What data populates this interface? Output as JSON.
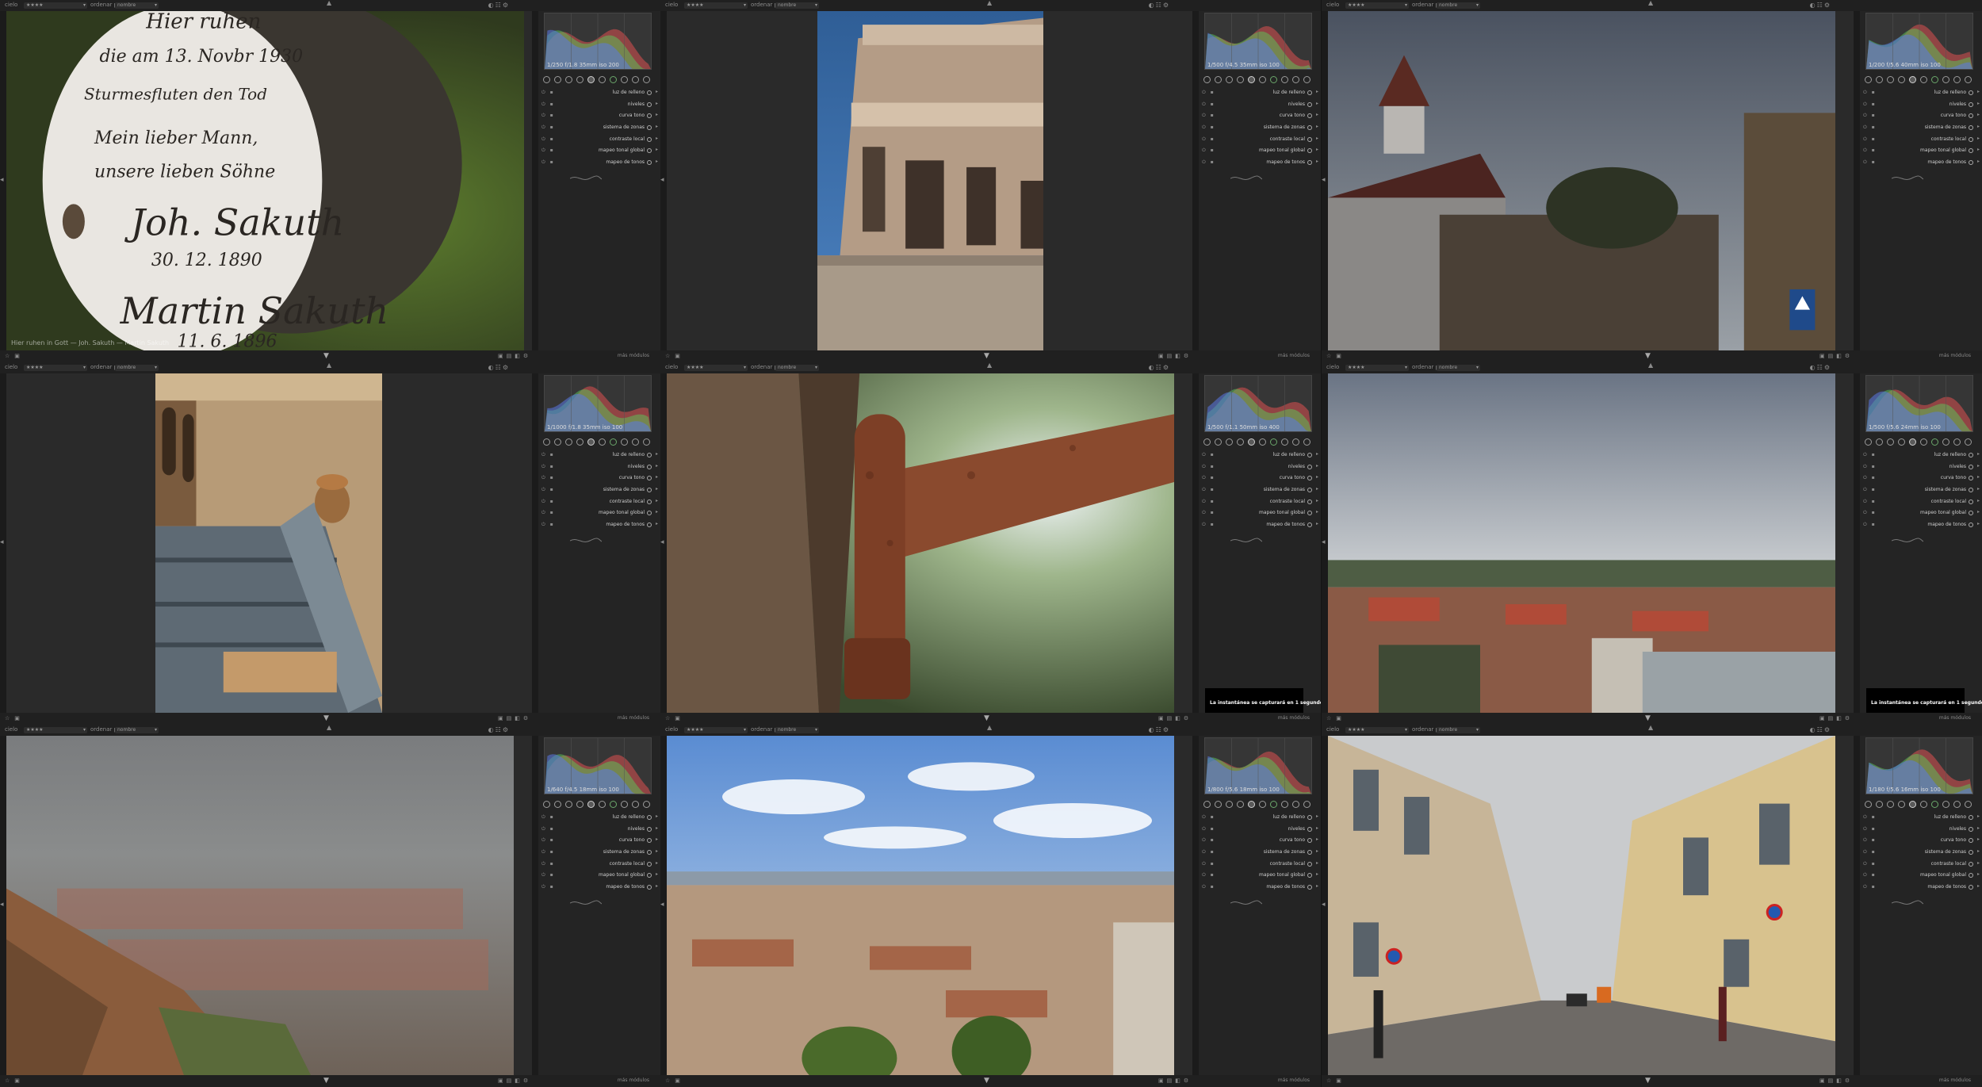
{
  "app": {
    "top_label": "cielo",
    "bottom_more_label": "más módulos",
    "sort_label": "ordenar por",
    "sort_value": "nombre",
    "rating_value": "★★★★"
  },
  "modules": [
    {
      "name": "luz de relleno",
      "icon": "circle-half-icon"
    },
    {
      "name": "niveles",
      "icon": "circle-icon"
    },
    {
      "name": "curva tono",
      "icon": "circle-icon"
    },
    {
      "name": "sistema de zonas",
      "icon": "zones-icon"
    },
    {
      "name": "contraste local",
      "icon": "circle-icon"
    },
    {
      "name": "mapeo tonal global",
      "icon": "circle-icon"
    },
    {
      "name": "mapeo de tonos",
      "icon": "tone-icon"
    }
  ],
  "cells": [
    {
      "exif": "1/250 f/1.8 35mm iso 200",
      "photo": {
        "name": "cemetery-plaque",
        "caption": "Hier ruhen in Gott — Joh. Sakuth — Martin Sakuth"
      },
      "toast": ""
    },
    {
      "exif": "1/500 f/4.5 35mm iso 100",
      "photo": {
        "name": "ruined-tower",
        "caption": ""
      },
      "toast": ""
    },
    {
      "exif": "1/200 f/5.6 40mm iso 100",
      "photo": {
        "name": "orthodox-church",
        "caption": ""
      },
      "toast": ""
    },
    {
      "exif": "1/1000 f/1.8 35mm iso 100",
      "photo": {
        "name": "weathered-boat",
        "caption": ""
      },
      "toast": ""
    },
    {
      "exif": "1/500 f/1.1 50mm iso 400",
      "photo": {
        "name": "rusty-hinge",
        "caption": ""
      },
      "toast": "La instantánea se capturará en 1 segundo"
    },
    {
      "exif": "1/500 f/5.6 24mm iso 100",
      "photo": {
        "name": "city-panorama",
        "caption": ""
      },
      "toast": "La instantánea se capturará en 1 segundo"
    },
    {
      "exif": "1/640 f/4.5 18mm iso 100",
      "photo": {
        "name": "foggy-city",
        "caption": ""
      },
      "toast": ""
    },
    {
      "exif": "1/800 f/5.6 18mm iso 100",
      "photo": {
        "name": "granada-rooftops",
        "caption": ""
      },
      "toast": ""
    },
    {
      "exif": "1/180 f/5.6 16mm iso 100",
      "photo": {
        "name": "old-town-street",
        "caption": ""
      },
      "toast": ""
    }
  ]
}
